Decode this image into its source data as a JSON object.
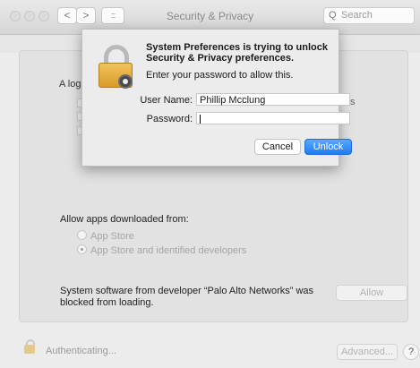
{
  "window": {
    "title": "Security & Privacy"
  },
  "toolbar": {
    "back_glyph": "<",
    "forward_glyph": ">",
    "grid_glyph": ":::",
    "search_icon": "Q",
    "search_placeholder": "Search"
  },
  "panel": {
    "partial_label": "A log",
    "partial_label_right": "s",
    "allow_heading": "Allow apps downloaded from:",
    "radio_options": [
      {
        "label": "App Store",
        "selected": false
      },
      {
        "label": "App Store and identified developers",
        "selected": true
      }
    ],
    "blocked_message": "System software from developer “Palo Alto Networks” was blocked from loading.",
    "allow_label": "Allow"
  },
  "footer": {
    "status": "Authenticating...",
    "advanced_label": "Advanced...",
    "help_label": "?"
  },
  "dialog": {
    "title": "System Preferences is trying to unlock Security & Privacy preferences.",
    "subtitle": "Enter your password to allow this.",
    "user_label": "User Name:",
    "user_value": "Phillip Mcclung",
    "password_label": "Password:",
    "password_value": "",
    "cancel_label": "Cancel",
    "unlock_label": "Unlock"
  },
  "colors": {
    "accent": "#1f7cf0",
    "lock": "#e5a93a"
  }
}
